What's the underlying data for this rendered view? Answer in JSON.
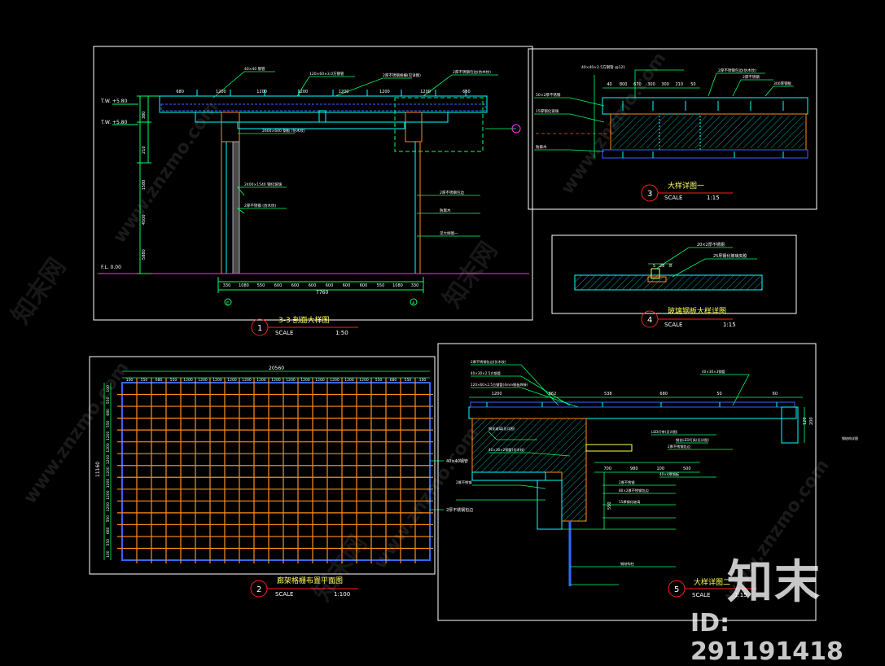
{
  "colors": {
    "frame": "#ffffff",
    "dim": "#00ff66",
    "leader": "#00ff66",
    "struct_cyan": "#00ffff",
    "struct_blue": "#3366ff",
    "grid_orange": "#ff8c1a",
    "accent_red": "#ff2020",
    "magenta": "#ff33ff",
    "label_yellow": "#ffff55",
    "text_white": "#ffffff"
  },
  "drawing1": {
    "number": "1",
    "title": "3-3 剖面大样图",
    "scale_label": "SCALE",
    "scale_value": "1:50",
    "levels": [
      "T.W. +5.80",
      "T.W. +5.80",
      "F.L. 0.00"
    ],
    "top_dims": [
      "680",
      "1200",
      "1200",
      "1200",
      "1200",
      "1200",
      "1200",
      "680"
    ],
    "bottom_dims": [
      "330",
      "1080",
      "550",
      "600",
      "600",
      "600",
      "600",
      "600",
      "600",
      "550",
      "1080",
      "330"
    ],
    "bottom_total": "7760",
    "grid_axes": [
      "E",
      "A"
    ],
    "notes": [
      "40×40 钢管",
      "120×60×3.0方钢管",
      "2厚不锈钢格栅(见详图)",
      "2厚不锈钢包边(仿木纹)",
      "2400×1540 钢化玻璃",
      "2厚不锈钢 (仿木纹)",
      "2600×600 钢板 (仿木纹)",
      "2厚不锈钢包边",
      "防腐木",
      "见大样图一"
    ],
    "left_dims": [
      "380",
      "210",
      "1580",
      "4500",
      "5880"
    ]
  },
  "drawing2": {
    "number": "2",
    "title": "廊架格栅布置平面图",
    "scale_label": "SCALE",
    "scale_value": "1:100",
    "total_width": "20560",
    "total_height": "11160",
    "top_dims": [
      "100",
      "550",
      "680",
      "550",
      "1200",
      "1200",
      "1200",
      "1200",
      "1200",
      "1200",
      "1200",
      "1200",
      "1200",
      "1200",
      "1200",
      "1200",
      "1200",
      "550",
      "680",
      "550",
      "100"
    ],
    "left_dims": [
      "100",
      "550",
      "680",
      "550",
      "1200",
      "1200",
      "1200",
      "1200",
      "1200",
      "1200",
      "1200",
      "550",
      "680",
      "550",
      "100"
    ],
    "notes": [
      "40×40钢管",
      "2厚不锈钢包边"
    ]
  },
  "drawing3": {
    "number": "3",
    "title": "大样详图一",
    "scale_label": "SCALE",
    "scale_value": "1:15",
    "dims": [
      "40",
      "800",
      "670",
      "300",
      "300",
      "210",
      "50"
    ],
    "notes": [
      "40×40×2.5方钢管 @121",
      "2厚不锈钢包边(仿木纹)",
      "2厚不锈钢",
      "300厚钢板",
      "50×2厚不锈钢",
      "15厚钢化玻璃",
      "防腐木"
    ]
  },
  "drawing4": {
    "number": "4",
    "title": "玻璃钢板大样详图",
    "scale_label": "SCALE",
    "scale_value": "1:15",
    "dims": [
      "5",
      "28",
      "8"
    ],
    "notes": [
      "20×2厚不锈钢",
      "25厚钢化玻璃夹胶"
    ]
  },
  "drawing5": {
    "number": "5",
    "title": "大样详图二",
    "scale_label": "SCALE",
    "scale_value": "1:15",
    "top_dims": [
      "1200",
      "862",
      "538",
      "680",
      "50",
      "60"
    ],
    "mid_dims": [
      "700",
      "980",
      "100",
      "500"
    ],
    "right_dims": [
      "120",
      "200"
    ],
    "vert_dims": [
      "550"
    ],
    "notes": [
      "2厚不锈钢包边(仿木纹)",
      "40×30×2.5方钢管",
      "120×60×2.5方钢管(4mm钢板焊接)",
      "40×30×3钢管",
      "钢化玻璃(见详图)",
      "40×30×2钢管(仿木纹)",
      "2厚不锈钢",
      "LED灯带(见详图)",
      "钢化LED灯具(见详图)",
      "2厚不锈钢包边",
      "40×4厚钢板",
      "2厚不锈钢",
      "80×2厚不锈钢包边",
      "15厚钢化玻璃",
      "钢结构柱"
    ],
    "side_label": "钢结构详图"
  },
  "watermarks": {
    "site": "www.znzmo.com",
    "brand": "知末网",
    "logo": "知末",
    "id_text": "ID: 291191418"
  }
}
